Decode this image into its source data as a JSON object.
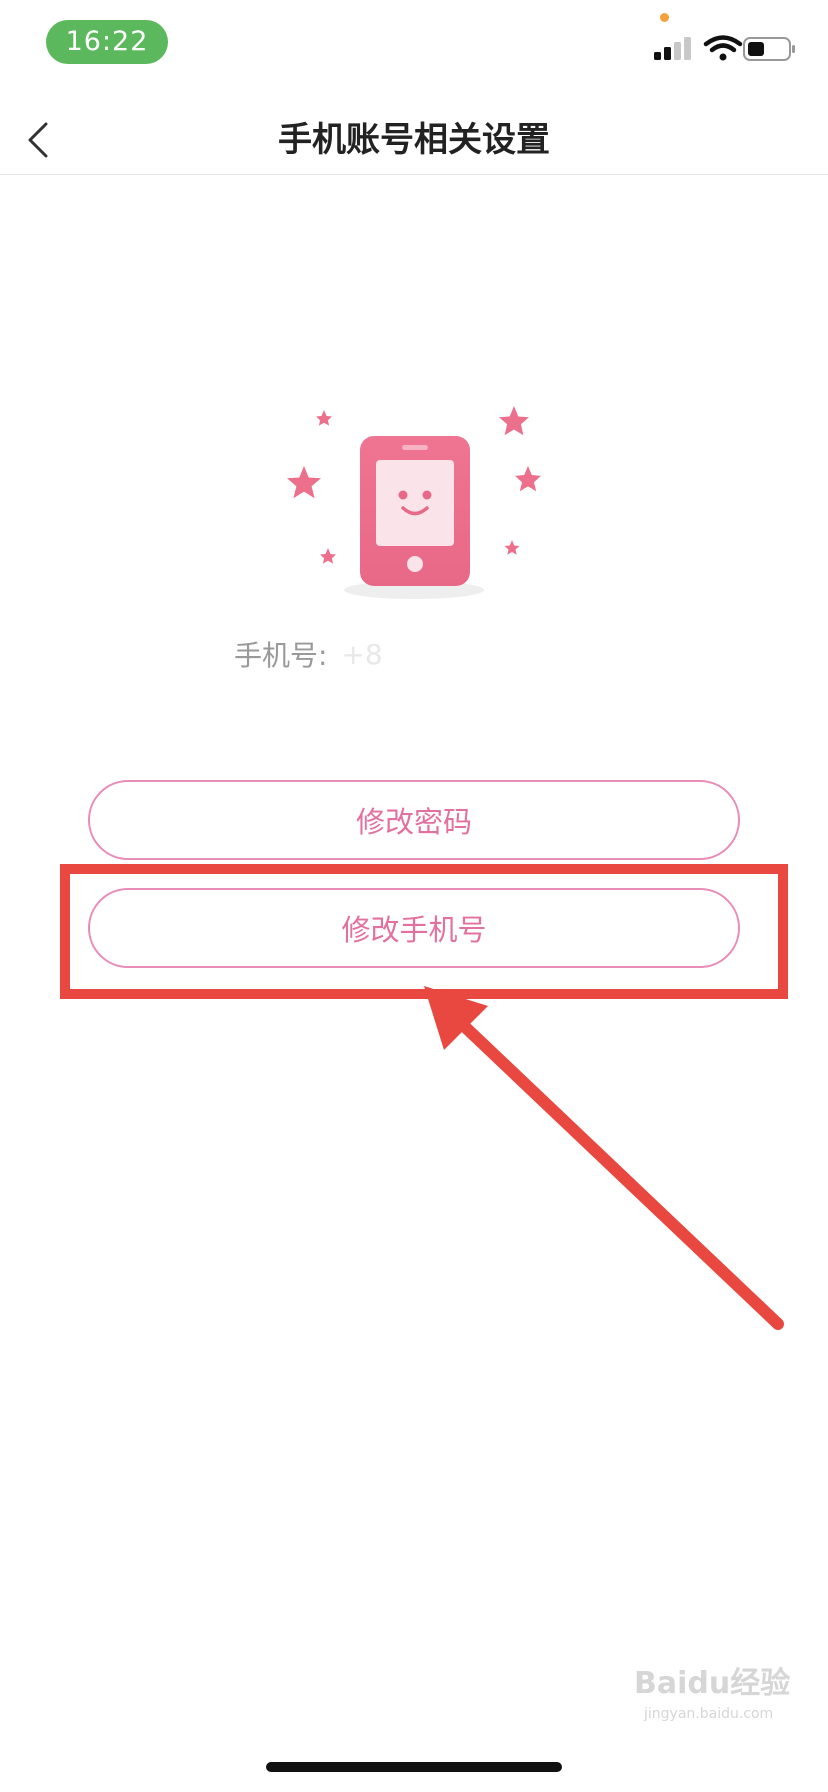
{
  "status_bar": {
    "time": "16:22",
    "signal_icon": "cellular-signal-icon",
    "wifi_icon": "wifi-icon",
    "battery_icon": "battery-icon",
    "dot_color": "#f5a03a"
  },
  "nav": {
    "back_icon": "chevron-left-icon",
    "title": "手机账号相关设置"
  },
  "illustration": {
    "icon": "smiling-phone-with-stars-icon",
    "primary_color": "#ec6f8c"
  },
  "account": {
    "phone_label": "手机号:",
    "phone_value": "+8"
  },
  "buttons": {
    "change_password": "修改密码",
    "change_phone": "修改手机号",
    "accent_color": "#e3719f"
  },
  "annotation": {
    "color": "#e8483f"
  },
  "watermark": {
    "brand": "Baidu经验",
    "domain": "jingyan.baidu.com"
  }
}
